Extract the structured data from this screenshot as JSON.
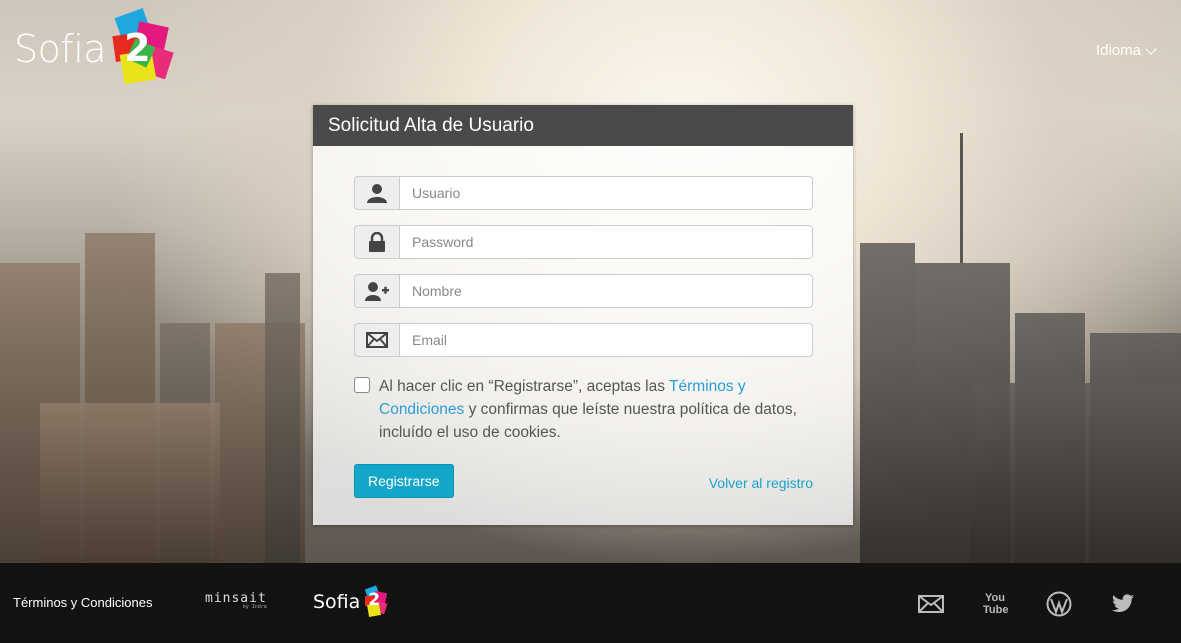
{
  "header": {
    "logo_text": "Sofia",
    "logo_number": "2",
    "language_label": "Idioma"
  },
  "form": {
    "title": "Solicitud Alta de Usuario",
    "fields": [
      {
        "placeholder": "Usuario",
        "icon": "user-icon"
      },
      {
        "placeholder": "Password",
        "icon": "lock-icon"
      },
      {
        "placeholder": "Nombre",
        "icon": "add-user-icon"
      },
      {
        "placeholder": "Email",
        "icon": "envelope-icon"
      }
    ],
    "terms_prefix": "Al hacer clic en “Registrarse”, aceptas las ",
    "terms_link": "Términos y Condiciones",
    "terms_suffix": " y confirmas que leíste nuestra política de datos, incluído el uso de cookies.",
    "submit_label": "Registrarse",
    "back_link": "Volver al registro"
  },
  "footer": {
    "terms_link": "Términos y Condiciones",
    "minsait": "minsait",
    "minsait_sub": "by Indra",
    "sofia_text": "Sofia",
    "sofia_number": "2",
    "social": [
      "mail-icon",
      "youtube-icon",
      "wordpress-icon",
      "twitter-icon"
    ],
    "youtube_text": "You Tube"
  },
  "colors": {
    "accent": "#12a7c9",
    "link": "#2a9fd6",
    "header_bar": "#4a4a4a"
  }
}
